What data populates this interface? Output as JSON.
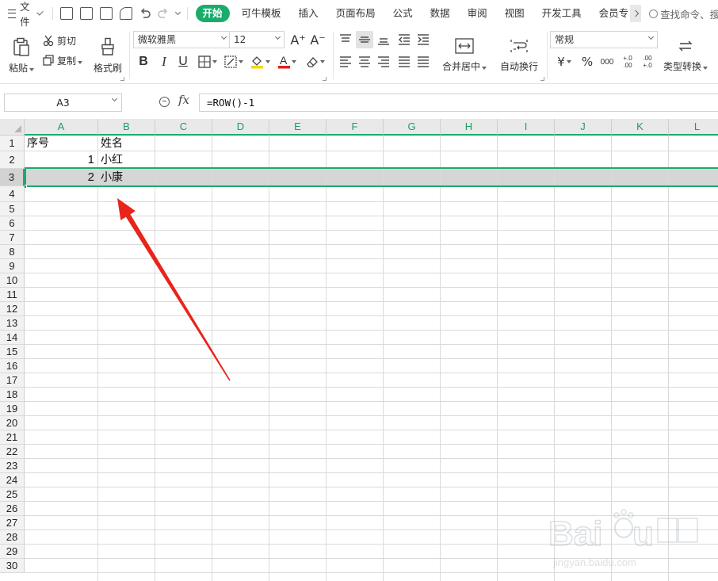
{
  "menubar": {
    "file_label": "文件",
    "tabs": [
      "开始",
      "可牛模板",
      "插入",
      "页面布局",
      "公式",
      "数据",
      "审阅",
      "视图",
      "开发工具",
      "会员专"
    ],
    "search_placeholder": "查找命令、搜"
  },
  "ribbon": {
    "paste_label": "粘贴",
    "cut_label": "剪切",
    "copy_label": "复制",
    "format_painter_label": "格式刷",
    "font_name": "微软雅黑",
    "font_size": "12",
    "bold": "B",
    "italic": "I",
    "underline": "U",
    "merge_center_label": "合并居中",
    "wrap_text_label": "自动换行",
    "number_format": "常规",
    "currency_symbol": "¥",
    "percent_symbol": "%",
    "thousands_symbol": "000",
    "dec_increase": "+.0 .00",
    "dec_decrease": ".00 +.0",
    "type_convert_label": "类型转换",
    "accent_color": "#1aac6b",
    "font_color": "#e02020",
    "fill_color": "#f5d800"
  },
  "formula_bar": {
    "name_box": "A3",
    "fx_label": "fx",
    "formula": "=ROW()-1"
  },
  "sheet": {
    "columns": [
      "A",
      "B",
      "C",
      "D",
      "E",
      "F",
      "G",
      "H",
      "I",
      "J",
      "K",
      "L"
    ],
    "rows": [
      "1",
      "2",
      "3",
      "4",
      "5",
      "6",
      "7",
      "8",
      "9",
      "10",
      "11",
      "12",
      "13",
      "14",
      "15",
      "16",
      "17",
      "18",
      "19",
      "20",
      "21",
      "22",
      "23",
      "24",
      "25",
      "26",
      "27",
      "28",
      "29",
      "30"
    ],
    "cells": {
      "A1": "序号",
      "B1": "姓名",
      "A2": "1",
      "B2": "小红",
      "A3": "2",
      "B3": "小康"
    },
    "selected_cell": "A3",
    "selected_row": "3"
  },
  "annotation": {
    "arrow_color": "#e8241c"
  },
  "watermark": {
    "brand": "Baidu经验",
    "url": "jingyan.baidu.com"
  }
}
